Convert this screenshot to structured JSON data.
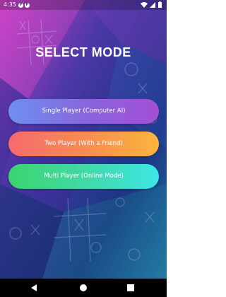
{
  "status_bar": {
    "time": "4:35",
    "app_icons": [
      "P",
      "P"
    ],
    "right_icons": [
      "wifi-icon",
      "signal-icon",
      "battery-icon"
    ]
  },
  "screen": {
    "title": "SELECT MODE"
  },
  "modes": [
    {
      "label": "Single Player (Computer AI)",
      "colors": [
        "#6e8ff0",
        "#a44fd6"
      ]
    },
    {
      "label": "Two Player (With a Friend)",
      "colors": [
        "#f56a6e",
        "#fbb53b"
      ]
    },
    {
      "label": "Multi Player (Online Mode)",
      "colors": [
        "#3cd46e",
        "#3de6e6"
      ]
    }
  ],
  "nav_bar": {
    "icons": [
      "back-icon",
      "home-icon",
      "recents-icon"
    ]
  },
  "background": {
    "icon": "tic-tac-toe-pattern",
    "colors": [
      "#c63fc9",
      "#4a38a6",
      "#1b2f7a",
      "#2a8fb0"
    ]
  }
}
